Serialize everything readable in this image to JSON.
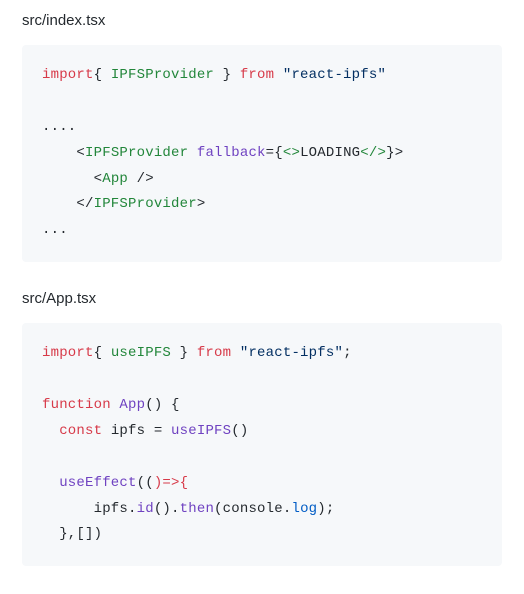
{
  "block1": {
    "file": "src/index.tsx",
    "code": {
      "l1": {
        "kw1": "import",
        "brace1": "{ ",
        "name": "IPFSProvider",
        "brace2": " }",
        "kw2": " from ",
        "str": "\"react-ipfs\""
      },
      "l2": "",
      "l3": "....",
      "l4": {
        "open": "<",
        "tag": "IPFSProvider",
        "sp": " ",
        "attr": "fallback",
        "eq": "=",
        "b1": "{",
        "fopen": "<>",
        "txt": "LOADING",
        "fclose": "</>",
        "b2": "}",
        "close": ">"
      },
      "l5": {
        "open": "<",
        "tag": "App",
        "close": " />"
      },
      "l6": {
        "open": "</",
        "tag": "IPFSProvider",
        "close": ">"
      },
      "l7": "..."
    }
  },
  "block2": {
    "file": "src/App.tsx",
    "code": {
      "l1": {
        "kw1": "import",
        "brace1": "{ ",
        "name": "useIPFS",
        "brace2": " }",
        "kw2": " from ",
        "str": "\"react-ipfs\"",
        "semi": ";"
      },
      "l2": "",
      "l3": {
        "kw": "function",
        "sp": " ",
        "fn": "App",
        "rest": "() {"
      },
      "l4": {
        "kw": "const",
        "sp": " ",
        "var": "ipfs",
        "eq": " = ",
        "fn": "useIPFS",
        "rest": "()"
      },
      "l5": "",
      "l6": {
        "fn": "useEffect",
        "open": "((",
        "arrow": ")=>{",
        "close": ""
      },
      "l7": {
        "obj": "ipfs",
        "dot1": ".",
        "m1": "id",
        "p1": "().",
        "m2": "then",
        "p2": "(console.",
        "m3": "log",
        "p3": ");"
      },
      "l8": "  },[])"
    }
  }
}
